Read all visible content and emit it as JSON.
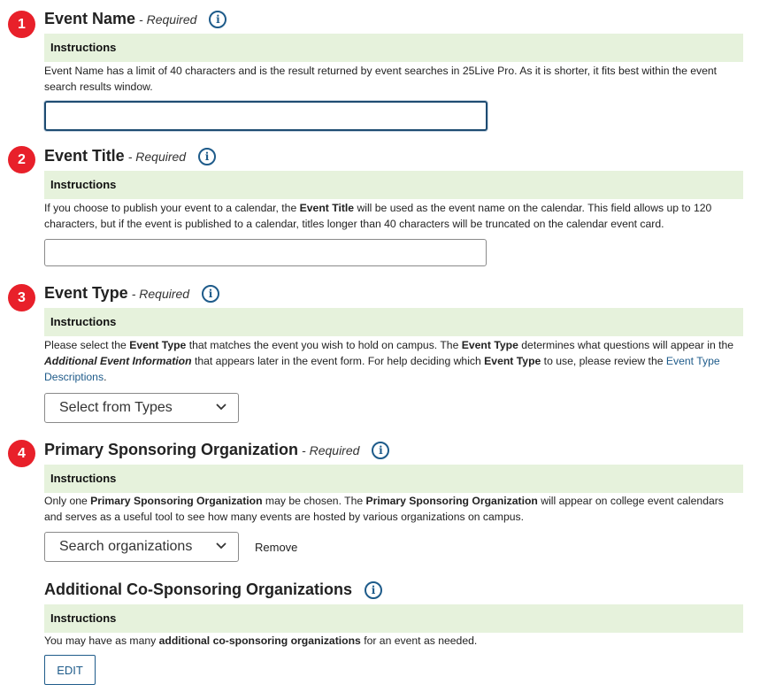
{
  "sections": {
    "event_name": {
      "number": "1",
      "title": "Event Name",
      "required": "- Required",
      "instructions_label": "Instructions",
      "description": "Event Name has a limit of 40 characters and is the result returned by event searches in 25Live Pro.  As it is shorter, it fits best within the event search results window.",
      "input_value": ""
    },
    "event_title": {
      "number": "2",
      "title": "Event Title",
      "required": "- Required",
      "instructions_label": "Instructions",
      "desc_part1": "If you choose to publish your event to a calendar, the ",
      "desc_bold1": "Event Title",
      "desc_part2": " will be used as the event name on the calendar. This field allows up to 120 characters, but if the event is published to a calendar, titles longer than 40 characters will be truncated on the calendar event card.",
      "input_value": ""
    },
    "event_type": {
      "number": "3",
      "title": "Event Type",
      "required": "- Required",
      "instructions_label": "Instructions",
      "desc_part1": "Please select the ",
      "desc_bold1": "Event Type",
      "desc_part2": " that matches the event you wish to hold on campus.  The ",
      "desc_bold2": "Event Type",
      "desc_part3": " determines what questions will appear in the ",
      "desc_bolditalic": "Additional Event Information",
      "desc_part4": " that appears later in the event form. For help deciding which ",
      "desc_bold3": "Event Type",
      "desc_part5": " to use, please review the ",
      "desc_link": "Event Type Descriptions",
      "desc_part6": ".",
      "dropdown_label": "Select from Types"
    },
    "primary_sponsor": {
      "number": "4",
      "title": "Primary Sponsoring Organization",
      "required": "- Required",
      "instructions_label": "Instructions",
      "desc_part1": "Only one ",
      "desc_bold1": "Primary Sponsoring Organization",
      "desc_part2": " may be chosen.  The ",
      "desc_bold2": "Primary Sponsoring Organization",
      "desc_part3": " will appear on college event calendars and serves as a useful tool to see how many events are hosted by various organizations on campus.",
      "dropdown_label": "Search organizations",
      "remove_label": "Remove"
    },
    "co_sponsors": {
      "title": "Additional Co-Sponsoring Organizations",
      "instructions_label": "Instructions",
      "desc_part1": "You may have as many ",
      "desc_bold1": "additional co-sponsoring organizations",
      "desc_part2": " for an event as needed.",
      "edit_label": "EDIT"
    }
  },
  "icons": {
    "info": "i",
    "chevron": "chevron-down-icon"
  },
  "colors": {
    "badge": "#e8202a",
    "instructions_bg": "#e6f2dc",
    "accent": "#1e5b8a"
  }
}
